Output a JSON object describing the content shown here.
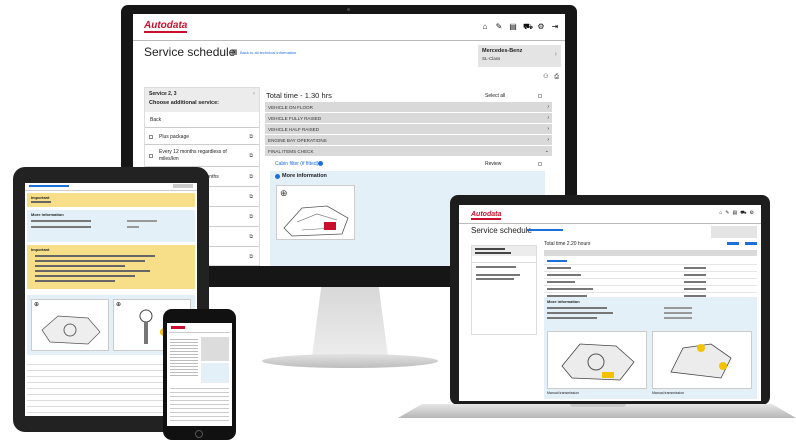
{
  "monitor": {
    "logo": "Autodata",
    "page_title": "Service schedule",
    "back_link": "Back to all technical information",
    "vehicle_make": "Mercedes-Benz",
    "vehicle_model": "SL-Class",
    "left_header": "Service 2, 3",
    "left_sub": "Choose additional service:",
    "back_label": "Back",
    "service_items": [
      "Plus package",
      "Every 12 months regardless of miles/km",
      "Service 4 Every 24 months",
      "",
      "",
      "",
      "",
      ""
    ],
    "total_time": "Total time - 1.30 hrs",
    "select_all": "Select all",
    "sections": [
      "VEHICLE ON FLOOR",
      "VEHICLE FULLY RAISED",
      "VEHICLE HALF RAISED",
      "ENGINE BAY OPERATIONS",
      "FINAL ITEMS CHECK"
    ],
    "cabin_filter": "Cabin filter (if fitted)",
    "review": "Review",
    "more_info": "More information"
  },
  "tablet": {
    "important": "Important",
    "more_info": "More information",
    "important2": "Important"
  },
  "laptop": {
    "logo": "Autodata",
    "page_title": "Service schedule",
    "total_time": "Total time 2.20 hours",
    "more_info": "More information",
    "diagram1_caption": "Manual transmission",
    "diagram2_caption": "Manual transmission"
  },
  "colors": {
    "brand_red": "#c8102e",
    "accent_blue": "#1e6fd9",
    "info_blue": "#e3f0f8",
    "warning_yellow": "#f7df8a",
    "row_gray": "#d9d9d9"
  }
}
